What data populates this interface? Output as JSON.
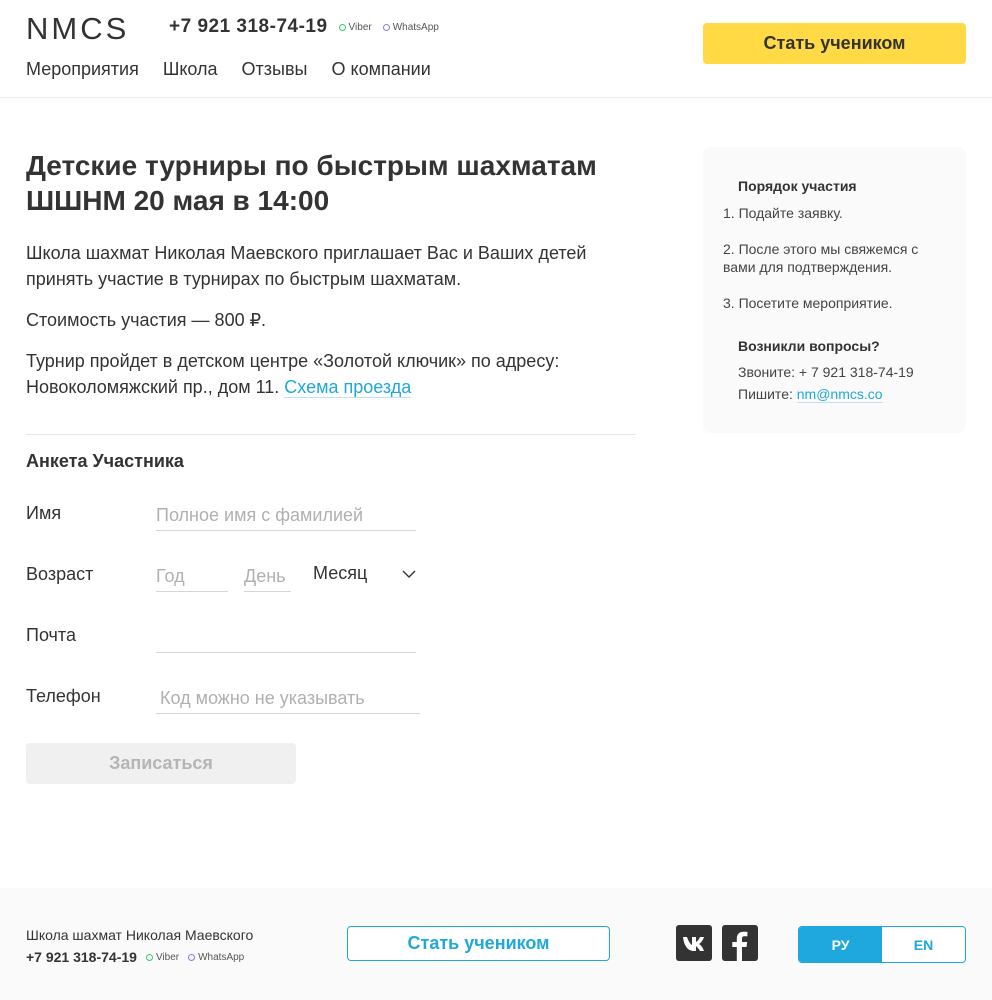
{
  "header": {
    "logo": "NMCS",
    "phone": "+7 921 318-74-19",
    "messengers": [
      {
        "label": "Viber",
        "color": "#3cc86a"
      },
      {
        "label": "WhatsApp",
        "color": "#8b7ce0"
      }
    ],
    "nav": [
      "Мероприятия",
      "Школа",
      "Отзывы",
      "О компании"
    ],
    "cta_label": "Стать учеником"
  },
  "main": {
    "title": "Детские турниры по быстрым шахматам ШШНМ 20 мая в 14:00",
    "intro": "Школа шахмат Николая Маевского приглашает Вас и Ваших детей принять участие в турнирах по быстрым шахматам.",
    "price": "Стоимость участия — 800 ₽.",
    "venue": "Турнир пройдет в детском центре «Золотой ключик» по адресу: Новоколомяжский пр., дом 11.",
    "map_link": "Схема проезда"
  },
  "form": {
    "title": "Анкета Участника",
    "name_label": "Имя",
    "name_placeholder": "Полное имя с фамилией",
    "age_label": "Возраст",
    "year_placeholder": "Год",
    "day_placeholder": "День",
    "month_value": "Месяц",
    "email_label": "Почта",
    "phone_label": "Телефон",
    "phone_placeholder": "Код можно не указывать",
    "submit_label": "Записаться"
  },
  "sidebar": {
    "order_title": "Порядок участия",
    "steps": [
      "1. Подайте заявку.",
      "2. После этого мы свяжемся с вами для подтверждения.",
      "3. Посетите мероприятие."
    ],
    "questions_title": "Возникли вопросы?",
    "call_text": "Звоните: + 7 921 318-74-19",
    "write_prefix": "Пишите:",
    "email": "nm@nmcs.co"
  },
  "footer": {
    "school": "Школа шахмат Николая Маевского",
    "phone": "+7 921 318-74-19",
    "messengers": [
      "Viber",
      "WhatsApp"
    ],
    "cta_label": "Стать учеником",
    "lang_ru": "РУ",
    "lang_en": "EN"
  },
  "colors": {
    "accent_yellow": "#ffda44",
    "accent_blue": "#1fa8dd",
    "text": "#333333"
  }
}
